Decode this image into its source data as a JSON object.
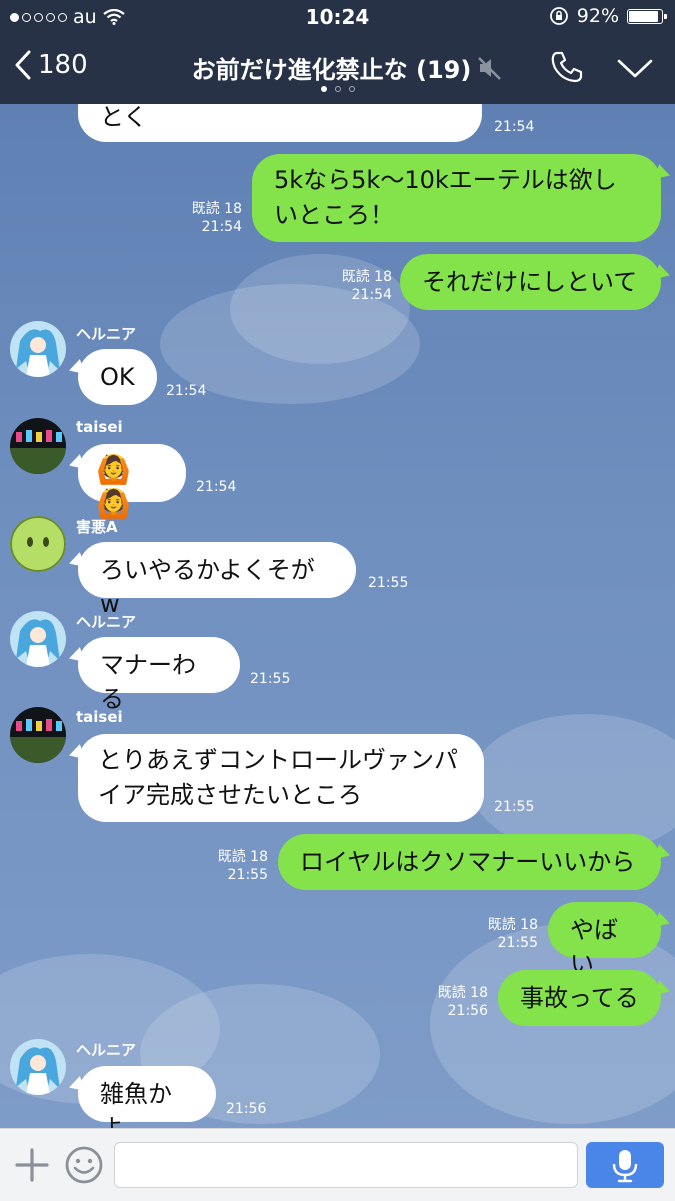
{
  "status": {
    "carrier": "au",
    "time": "10:24",
    "battery": "92%"
  },
  "header": {
    "back_count": "180",
    "title": "お前だけ進化禁止な (19)"
  },
  "messages": [
    {
      "dir": "in",
      "text": "とく",
      "time": "21:54"
    },
    {
      "dir": "out",
      "text": "5kなら5k〜10kエーテルは欲しいところ！",
      "read": "既読 18",
      "time": "21:54"
    },
    {
      "dir": "out",
      "text": "それだけにしといて",
      "read": "既読 18",
      "time": "21:54"
    },
    {
      "dir": "in",
      "sender": "ヘルニア",
      "text": "OK",
      "time": "21:54"
    },
    {
      "dir": "in",
      "sender": "taisei",
      "text": "🙆🙆",
      "time": "21:54"
    },
    {
      "dir": "in",
      "sender": "害悪A",
      "text": "ろいやるかよくそがw",
      "time": "21:55"
    },
    {
      "dir": "in",
      "sender": "ヘルニア",
      "text": "マナーわる",
      "time": "21:55"
    },
    {
      "dir": "in",
      "sender": "taisei",
      "text_line1": "とりあえずコントロールヴァンパ",
      "text_line2": "イア完成させたいところ",
      "time": "21:55"
    },
    {
      "dir": "out",
      "text": "ロイヤルはクソマナーいいから",
      "read": "既読 18",
      "time": "21:55"
    },
    {
      "dir": "out",
      "text": "やばい",
      "read": "既読 18",
      "time": "21:55"
    },
    {
      "dir": "out",
      "text": "事故ってる",
      "read": "既読 18",
      "time": "21:56"
    },
    {
      "dir": "in",
      "sender": "ヘルニア",
      "text": "雑魚かよ",
      "time": "21:56"
    }
  ],
  "input": {
    "placeholder": ""
  },
  "colors": {
    "header_bg": "#273246",
    "out_bubble": "#84e24b",
    "in_bubble": "#ffffff",
    "mic_button": "#4a86e8"
  },
  "icons": [
    "back-chevron-icon",
    "mute-icon",
    "phone-icon",
    "chevron-down-icon",
    "plus-icon",
    "smile-icon",
    "mic-icon"
  ]
}
